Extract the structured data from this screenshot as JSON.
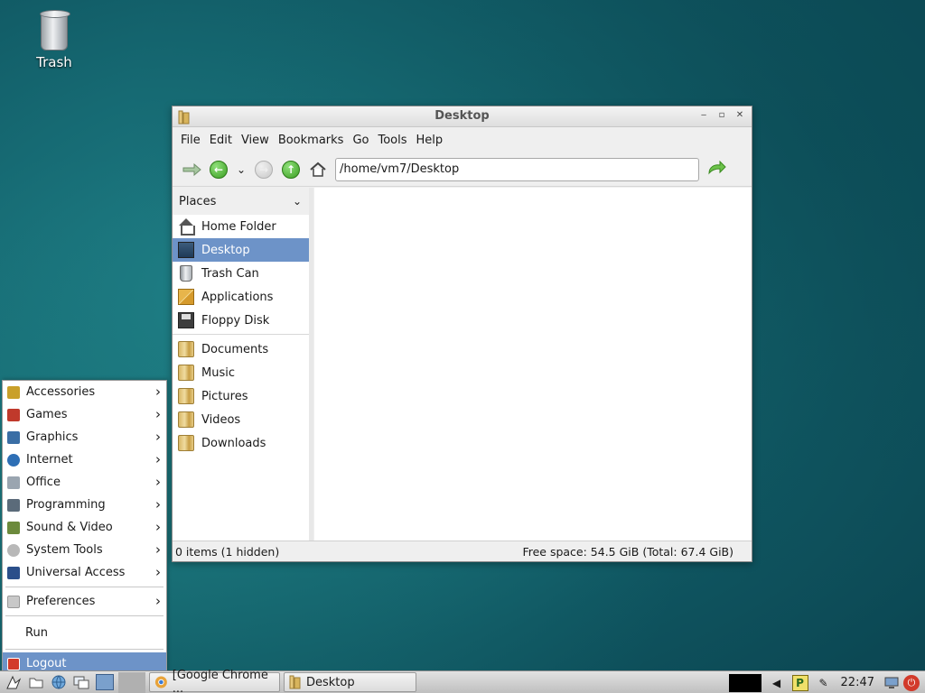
{
  "desktop": {
    "icons": [
      {
        "label": "Trash",
        "icon": "trash-icon"
      }
    ]
  },
  "window": {
    "title": "Desktop",
    "menu": [
      "File",
      "Edit",
      "View",
      "Bookmarks",
      "Go",
      "Tools",
      "Help"
    ],
    "address": "/home/vm7/Desktop",
    "places_header": "Places",
    "places": [
      {
        "label": "Home Folder",
        "icon": "home-icon"
      },
      {
        "label": "Desktop",
        "icon": "desktop-icon",
        "selected": true
      },
      {
        "label": "Trash Can",
        "icon": "trash-icon"
      },
      {
        "label": "Applications",
        "icon": "applications-icon"
      },
      {
        "label": "Floppy Disk",
        "icon": "floppy-icon"
      }
    ],
    "bookmarks": [
      {
        "label": "Documents",
        "icon": "folder-icon"
      },
      {
        "label": "Music",
        "icon": "folder-icon"
      },
      {
        "label": "Pictures",
        "icon": "folder-icon"
      },
      {
        "label": "Videos",
        "icon": "folder-icon"
      },
      {
        "label": "Downloads",
        "icon": "folder-icon"
      }
    ],
    "status_left": "0 items (1 hidden)",
    "status_right": "Free space: 54.5 GiB (Total: 67.4 GiB)"
  },
  "start_menu": {
    "categories": [
      {
        "label": "Accessories",
        "color": "#c9a02a"
      },
      {
        "label": "Games",
        "color": "#c0392b"
      },
      {
        "label": "Graphics",
        "color": "#3a6ea5"
      },
      {
        "label": "Internet",
        "color": "#2e6fb5"
      },
      {
        "label": "Office",
        "color": "#9aa5b0"
      },
      {
        "label": "Programming",
        "color": "#5b6b7a"
      },
      {
        "label": "Sound & Video",
        "color": "#6c8a3c"
      },
      {
        "label": "System Tools",
        "color": "#b8b8b8"
      },
      {
        "label": "Universal Access",
        "color": "#2b4f8a"
      }
    ],
    "preferences": "Preferences",
    "run": "Run",
    "logout": "Logout"
  },
  "taskbar": {
    "tasks": [
      {
        "label": "[Google Chrome ...",
        "icon": "chrome-icon"
      },
      {
        "label": "Desktop",
        "icon": "folder-icon"
      }
    ],
    "clock": "22:47"
  }
}
